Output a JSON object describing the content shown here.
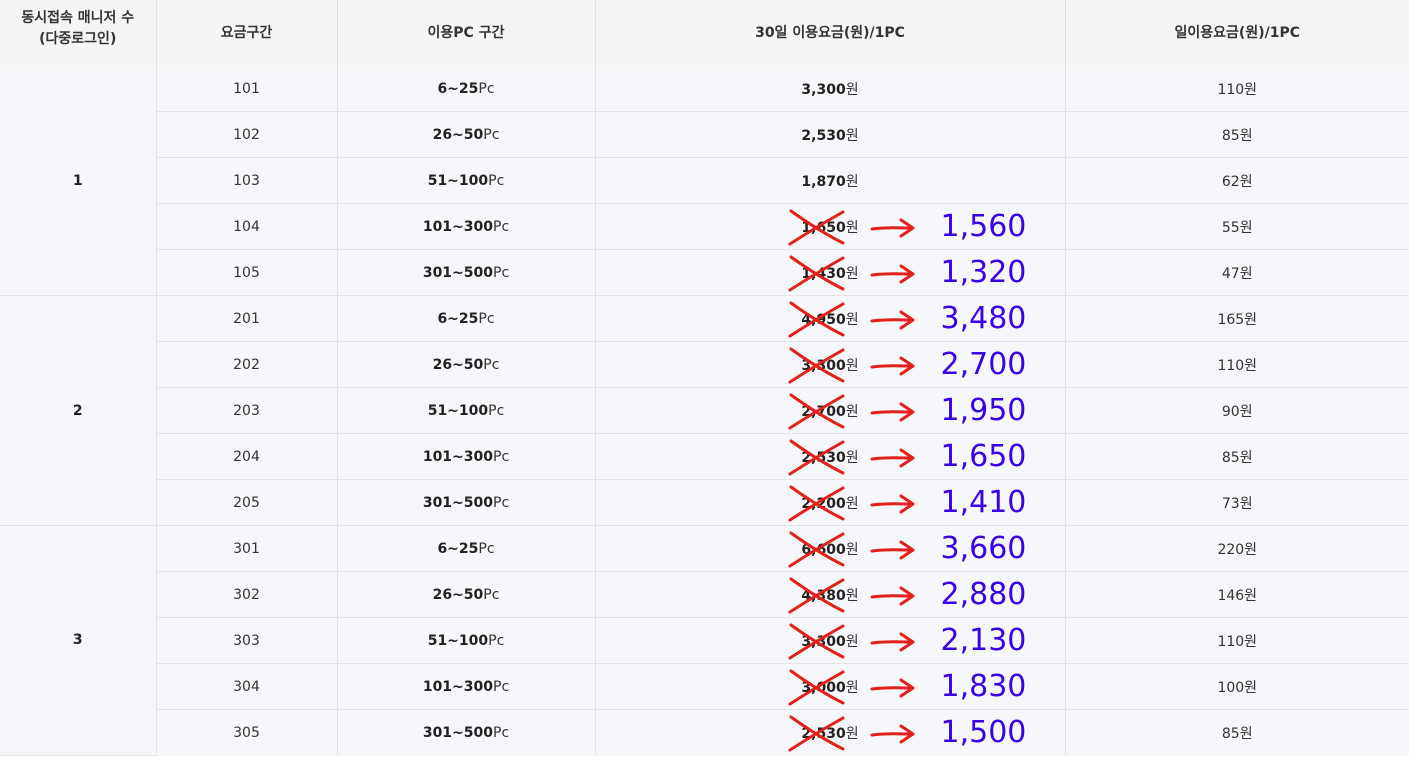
{
  "headers": {
    "group_line1": "동시접속 매니저 수",
    "group_line2": "(다중로그인)",
    "tier": "요금구간",
    "pc_range": "이용PC 구간",
    "monthly": "30일 이용요금(원)/1PC",
    "daily": "일이용요금(원)/1PC"
  },
  "units": {
    "pc": "Pc",
    "won": "원"
  },
  "colors": {
    "header_bg": "#f5f5f5",
    "row_bg": "#f6f7fa",
    "new_price": "#3b00e8",
    "strike_mark": "#e3201b"
  },
  "groups": [
    {
      "label": "1",
      "rows": [
        {
          "tier": "101",
          "pc": "6~25",
          "month": "3,300",
          "new_price": "",
          "day": "110원"
        },
        {
          "tier": "102",
          "pc": "26~50",
          "month": "2,530",
          "new_price": "",
          "day": "85원"
        },
        {
          "tier": "103",
          "pc": "51~100",
          "month": "1,870",
          "new_price": "",
          "day": "62원"
        },
        {
          "tier": "104",
          "pc": "101~300",
          "month": "1,650",
          "new_price": "1,560",
          "day": "55원"
        },
        {
          "tier": "105",
          "pc": "301~500",
          "month": "1,430",
          "new_price": "1,320",
          "day": "47원"
        }
      ]
    },
    {
      "label": "2",
      "rows": [
        {
          "tier": "201",
          "pc": "6~25",
          "month": "4,950",
          "new_price": "3,480",
          "day": "165원"
        },
        {
          "tier": "202",
          "pc": "26~50",
          "month": "3,300",
          "new_price": "2,700",
          "day": "110원"
        },
        {
          "tier": "203",
          "pc": "51~100",
          "month": "2,700",
          "new_price": "1,950",
          "day": "90원"
        },
        {
          "tier": "204",
          "pc": "101~300",
          "month": "2,530",
          "new_price": "1,650",
          "day": "85원"
        },
        {
          "tier": "205",
          "pc": "301~500",
          "month": "2,200",
          "new_price": "1,410",
          "day": "73원"
        }
      ]
    },
    {
      "label": "3",
      "rows": [
        {
          "tier": "301",
          "pc": "6~25",
          "month": "6,600",
          "new_price": "3,660",
          "day": "220원"
        },
        {
          "tier": "302",
          "pc": "26~50",
          "month": "4,380",
          "new_price": "2,880",
          "day": "146원"
        },
        {
          "tier": "303",
          "pc": "51~100",
          "month": "3,300",
          "new_price": "2,130",
          "day": "110원"
        },
        {
          "tier": "304",
          "pc": "101~300",
          "month": "3,000",
          "new_price": "1,830",
          "day": "100원"
        },
        {
          "tier": "305",
          "pc": "301~500",
          "month": "2,530",
          "new_price": "1,500",
          "day": "85원"
        }
      ]
    }
  ]
}
